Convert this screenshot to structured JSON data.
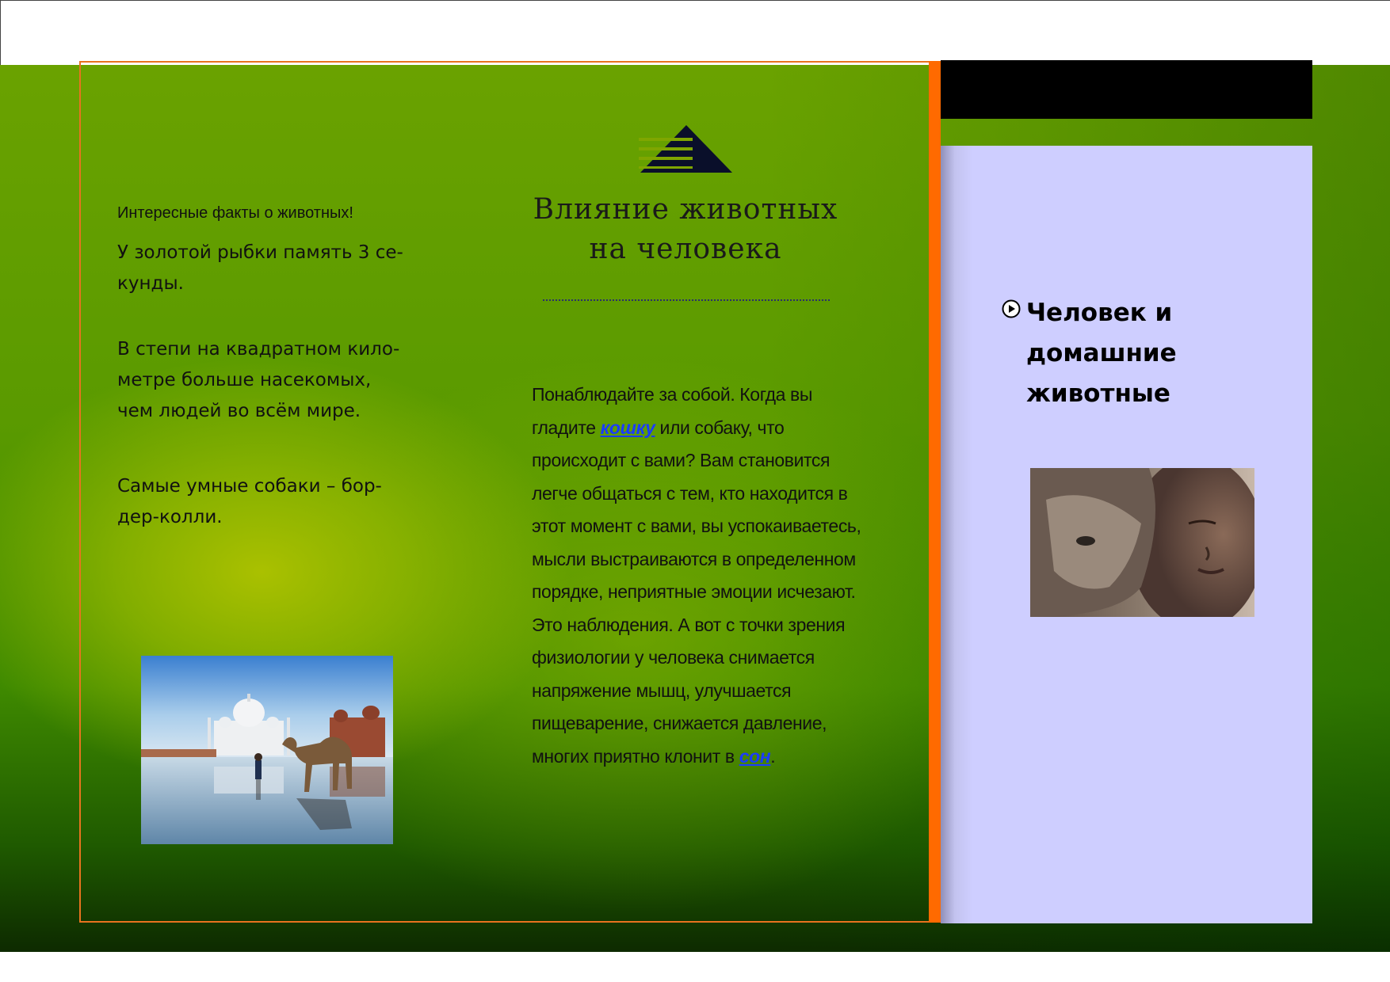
{
  "left_column": {
    "facts_title": "Интересные факты о животных!",
    "facts": [
      {
        "lines": [
          "У золотой рыбки память 3 се-",
          "кунды."
        ]
      },
      {
        "lines": [
          "В степи на квадратном кило-",
          "метре больше насекомых,",
          "чем людей во всём мире."
        ]
      },
      {
        "lines": [
          "Самые умные собаки – бор-",
          "дер-колли."
        ]
      }
    ]
  },
  "middle_column": {
    "title_line1": "Влияние животных",
    "title_line2": "на человека",
    "body": {
      "part1": "Понаблюдайте за собой. Когда вы гладите ",
      "link1": "кошку",
      "part2": " или собаку, что происходит с вами? Вам становится легче общаться с тем, кто находится в этот момент с вами, вы успокаиваетесь, мысли выстраиваются в определенном порядке, неприятные эмоции исчезают. Это наблюдения. А вот с точки зрения физиологии у человека снимается напряжение мышц, улучшается пищеварение, снижается давление, многих приятно клонит в ",
      "link2": "сон",
      "part3": "."
    }
  },
  "right_column": {
    "heading_line1": "Человек и",
    "heading_line2": "домашние",
    "heading_line3": "животные"
  },
  "colors": {
    "orange": "#ff6a00",
    "lavender": "#ceceff",
    "link": "#1a3cff"
  },
  "icons": {
    "logo": "pyramid-logo-icon",
    "bullet": "play-circle-icon"
  }
}
